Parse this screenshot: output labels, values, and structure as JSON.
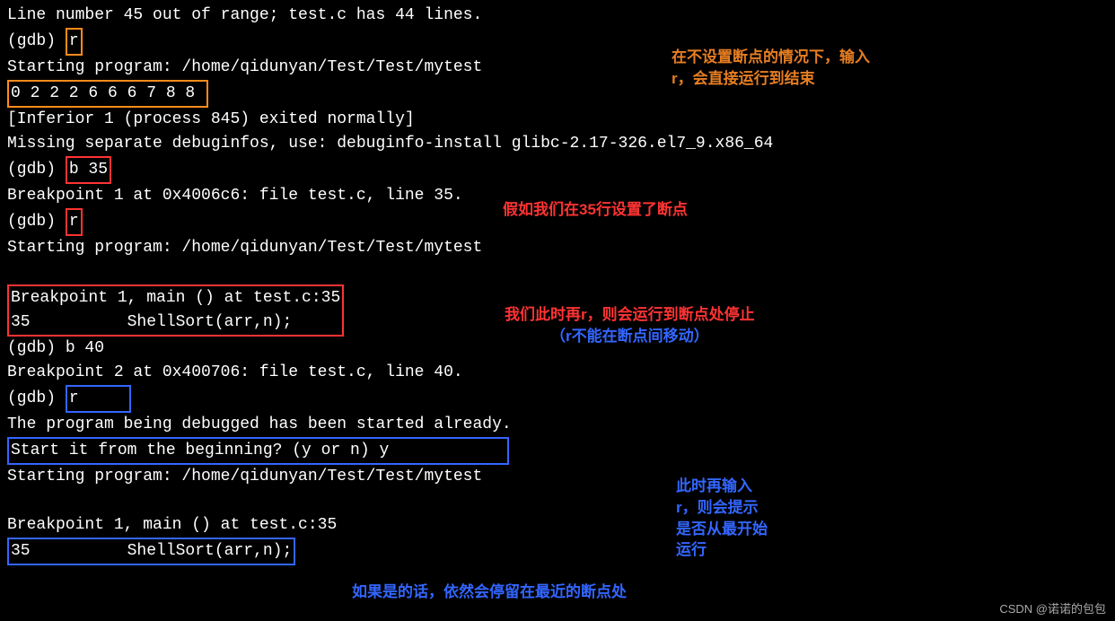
{
  "terminal": {
    "line1": "Line number 45 out of range; test.c has 44 lines.",
    "prompt": "(gdb) ",
    "cmd_r": "r",
    "starting_program": "Starting program: /home/qidunyan/Test/Test/mytest ",
    "output_sorted": "0 2 2 2 6 6 6 7 8 8 ",
    "inferior_exit": "[Inferior 1 (process 845) exited normally]",
    "missing_debuginfo": "Missing separate debuginfos, use: debuginfo-install glibc-2.17-326.el7_9.x86_64",
    "cmd_b35": "b 35",
    "breakpoint1_set": "Breakpoint 1 at 0x4006c6: file test.c, line 35.",
    "blank": "",
    "bp1_hit_line1": "Breakpoint 1, main () at test.c:35",
    "bp1_hit_line2": "35          ShellSort(arr,n);",
    "cmd_b40": "b 40",
    "breakpoint2_set": "Breakpoint 2 at 0x400706: file test.c, line 40.",
    "cmd_r_pad": "r     ",
    "already_started": "The program being debugged has been started already.",
    "start_beginning": "Start it from the beginning? (y or n) y            ",
    "bp1_hit2_line1": "Breakpoint 1, main () at test.c:35",
    "bp1_hit2_line2": "35          ShellSort(arr,n);"
  },
  "annotations": {
    "a1_line1": "在不设置断点的情况下，输入",
    "a1_line2": "r，会直接运行到结束",
    "a2": "假如我们在35行设置了断点",
    "a3_line1": "我们此时再r，则会运行到断点处停止",
    "a3_line2": "（r不能在断点间移动）",
    "a4_line1": "此时再输入",
    "a4_line2": "r，则会提示",
    "a4_line3": "是否从最开始",
    "a4_line4": "运行",
    "a5": "如果是的话，依然会停留在最近的断点处"
  },
  "watermark": "CSDN @诺诺的包包"
}
